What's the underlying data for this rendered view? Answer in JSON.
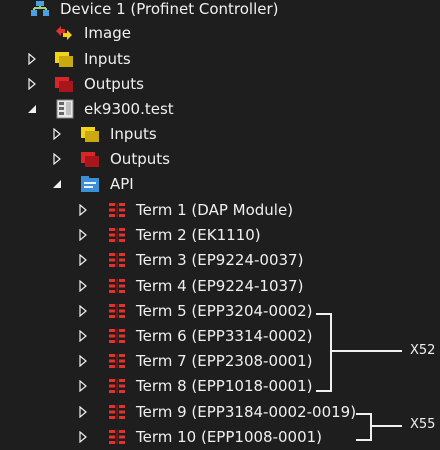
{
  "tree": {
    "device": {
      "label": "Device 1 (Profinet Controller)",
      "icon": "profinet-device-icon"
    },
    "image": {
      "label": "Image",
      "icon": "image-arrows-icon"
    },
    "inputs1": {
      "label": "Inputs",
      "icon": "inputs-folder-icon"
    },
    "outputs1": {
      "label": "Outputs",
      "icon": "outputs-folder-icon"
    },
    "box": {
      "label": "ek9300.test",
      "icon": "box-device-icon"
    },
    "inputs2": {
      "label": "Inputs",
      "icon": "inputs-folder-icon"
    },
    "outputs2": {
      "label": "Outputs",
      "icon": "outputs-folder-icon"
    },
    "api": {
      "label": "API",
      "icon": "api-icon"
    },
    "terms": [
      {
        "label": "Term 1 (DAP Module)"
      },
      {
        "label": "Term 2 (EK1110)"
      },
      {
        "label": "Term 3 (EP9224-0037)"
      },
      {
        "label": "Term 4 (EP9224-1037)"
      },
      {
        "label": "Term 5 (EPP3204-0002)"
      },
      {
        "label": "Term 6 (EPP3314-0002)"
      },
      {
        "label": "Term 7 (EPP2308-0001)"
      },
      {
        "label": "Term 8 (EPP1018-0001)"
      },
      {
        "label": "Term 9 (EPP3184-0002-0019)"
      },
      {
        "label": "Term 10 (EPP1008-0001)"
      }
    ]
  },
  "annotations": {
    "x52": "X52",
    "x55": "X55"
  },
  "colors": {
    "background": "#1e1e1e",
    "text": "#f0f0f0",
    "term_icon": "#e0332e",
    "inputs_icon": "#f2d21b",
    "outputs_icon": "#d9262b",
    "api_icon": "#3a8fd6"
  }
}
